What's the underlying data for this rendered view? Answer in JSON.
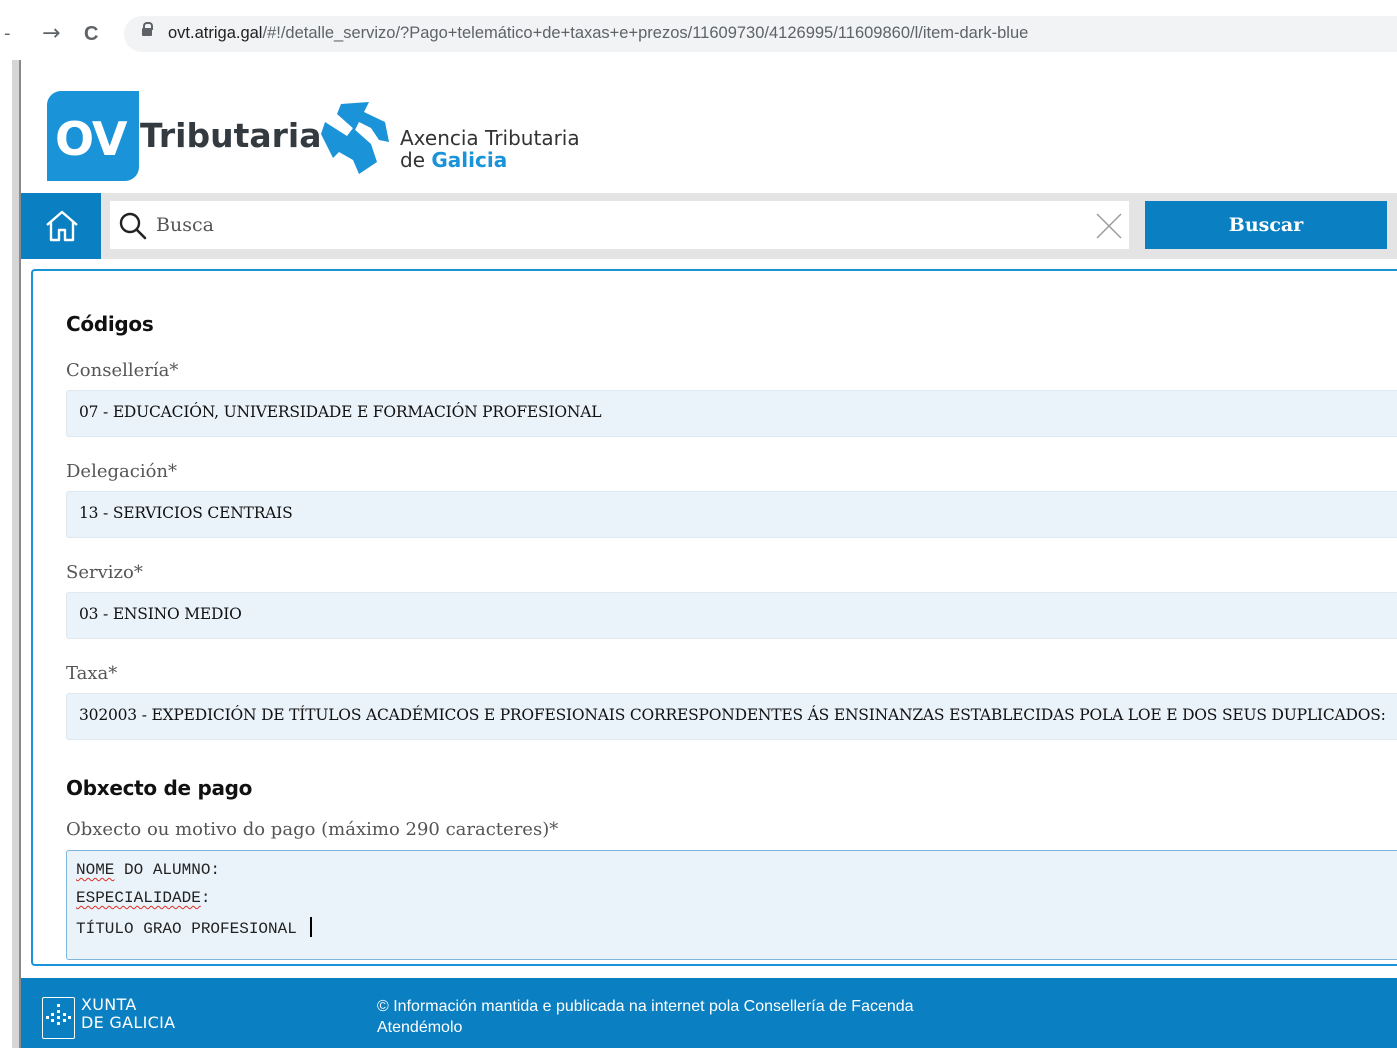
{
  "browser": {
    "back_icon": "minus",
    "forward_symbol": "→",
    "reload_symbol": "C",
    "url_domain": "ovt.atriga.gal",
    "url_path": "/#!/detalle_servizo/?Pago+telemático+de+taxas+e+prezos/11609730/4126995/11609860/l/item-dark-blue"
  },
  "header": {
    "ov_text": "OV",
    "tributaria_text": "Tributaria",
    "agency_line1": "Axencia Tributaria",
    "agency_line2_prefix": "de ",
    "agency_line2_bold": "Galicia",
    "brand_color": "#1b93d9"
  },
  "search": {
    "placeholder": "Busca",
    "button_label": "Buscar",
    "accent_color": "#0a7fc1"
  },
  "codigos": {
    "title": "Códigos",
    "fields": [
      {
        "label": "Consellería*",
        "value": "07 - EDUCACIÓN, UNIVERSIDADE E FORMACIÓN PROFESIONAL"
      },
      {
        "label": "Delegación*",
        "value": "13 - SERVICIOS CENTRAIS"
      },
      {
        "label": "Servizo*",
        "value": "03 - ENSINO MEDIO"
      },
      {
        "label": "Taxa*",
        "value": "302003 - EXPEDICIÓN DE TÍTULOS ACADÉMICOS E PROFESIONAIS CORRESPONDENTES ÁS ENSINANZAS ESTABLECIDAS POLA LOE E DOS SEUS DUPLICADOS:"
      }
    ]
  },
  "obxecto": {
    "title": "Obxecto de pago",
    "label": "Obxecto ou motivo do pago (máximo 290 caracteres)*",
    "lines": {
      "l1_word1": "NOME",
      "l1_rest": " DO ALUMNO:",
      "l2_word": "ESPECIALIDADE",
      "l2_rest": ":",
      "l3": "TÍTULO GRAO PROFESIONAL "
    }
  },
  "footer": {
    "xunta_line1": "XUNTA",
    "xunta_line2": "DE GALICIA",
    "info_line1": "© Información mantida e publicada na internet pola Consellería de Facenda",
    "info_line2": "Atendémolo"
  }
}
